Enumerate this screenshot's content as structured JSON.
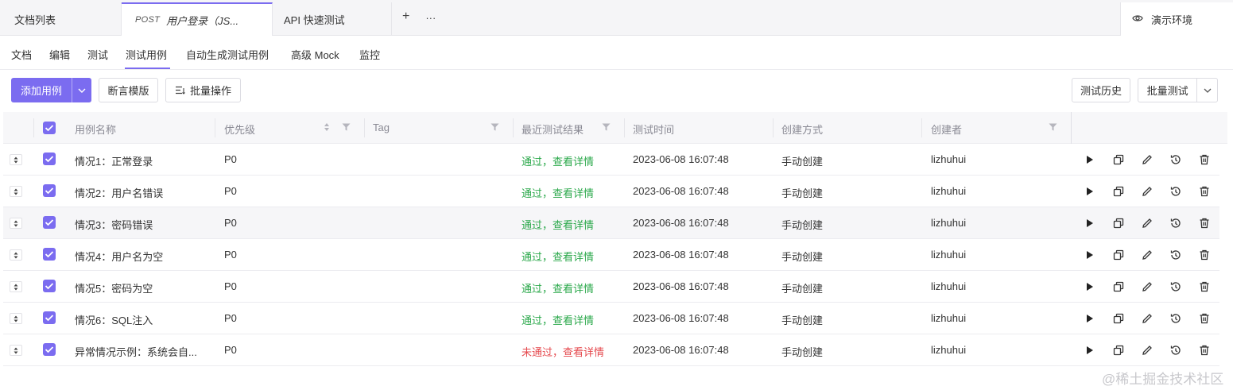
{
  "tabs": {
    "doc_list": "文档列表",
    "active_method": "POST",
    "active_title": "用户登录（JS...",
    "api_test": "API 快速测试",
    "add": "+",
    "more": "···",
    "env_label": "演示环境"
  },
  "subtabs": [
    "文档",
    "编辑",
    "测试",
    "测试用例",
    "自动生成测试用例",
    "高级 Mock",
    "监控"
  ],
  "toolbar": {
    "add_case": "添加用例",
    "assert_template": "断言模版",
    "batch_ops": "批量操作",
    "test_history": "测试历史",
    "batch_test": "批量测试"
  },
  "table": {
    "headers": {
      "name": "用例名称",
      "priority": "优先级",
      "tag": "Tag",
      "last_result": "最近测试结果",
      "test_time": "测试时间",
      "created_by_method": "创建方式",
      "creator": "创建者"
    },
    "rows": [
      {
        "name": "情况1：正常登录",
        "priority": "P0",
        "result": "通过，查看详情",
        "status": "pass",
        "time": "2023-06-08 16:07:48",
        "method": "手动创建",
        "creator": "lizhuhui"
      },
      {
        "name": "情况2：用户名错误",
        "priority": "P0",
        "result": "通过，查看详情",
        "status": "pass",
        "time": "2023-06-08 16:07:48",
        "method": "手动创建",
        "creator": "lizhuhui"
      },
      {
        "name": "情况3：密码错误",
        "priority": "P0",
        "result": "通过，查看详情",
        "status": "pass",
        "time": "2023-06-08 16:07:48",
        "method": "手动创建",
        "creator": "lizhuhui"
      },
      {
        "name": "情况4：用户名为空",
        "priority": "P0",
        "result": "通过，查看详情",
        "status": "pass",
        "time": "2023-06-08 16:07:48",
        "method": "手动创建",
        "creator": "lizhuhui"
      },
      {
        "name": "情况5：密码为空",
        "priority": "P0",
        "result": "通过，查看详情",
        "status": "pass",
        "time": "2023-06-08 16:07:48",
        "method": "手动创建",
        "creator": "lizhuhui"
      },
      {
        "name": "情况6：SQL注入",
        "priority": "P0",
        "result": "通过，查看详情",
        "status": "pass",
        "time": "2023-06-08 16:07:48",
        "method": "手动创建",
        "creator": "lizhuhui"
      },
      {
        "name": "异常情况示例：系统会自...",
        "priority": "P0",
        "result": "未通过，查看详情",
        "status": "fail",
        "time": "2023-06-08 16:07:48",
        "method": "手动创建",
        "creator": "lizhuhui"
      }
    ]
  },
  "watermark": "@稀土掘金技术社区",
  "colors": {
    "accent": "#7b6cf0",
    "pass": "#2aa84a",
    "fail": "#e5484d"
  }
}
